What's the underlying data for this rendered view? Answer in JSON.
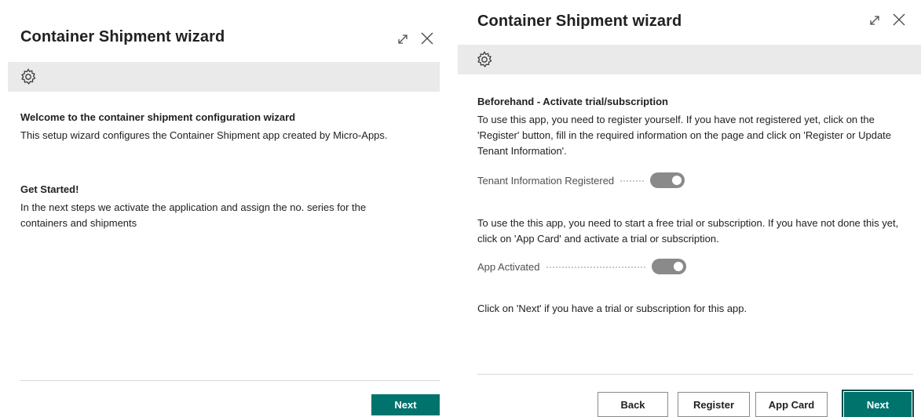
{
  "left_dialog": {
    "title": "Container Shipment wizard",
    "icons": {
      "expand": "expand-icon",
      "close": "close-icon",
      "settings": "gear-icon"
    },
    "welcome_heading": "Welcome to the container shipment configuration wizard",
    "welcome_text": "This setup wizard configures the Container Shipment app created by Micro-Apps.",
    "get_started_heading": "Get Started!",
    "get_started_text": "In the next steps we activate the application and assign the no. series for the containers and shipments",
    "buttons": {
      "next": "Next"
    }
  },
  "right_dialog": {
    "title": "Container Shipment wizard",
    "icons": {
      "expand": "expand-icon",
      "close": "close-icon",
      "settings": "gear-icon"
    },
    "heading": "Beforehand - Activate trial/subscription",
    "register_text": "To use this app, you need to register yourself. If you have not registered yet, click on the 'Register' button, fill in the required information on the page and click on 'Register or Update Tenant Information'.",
    "tenant_field": {
      "label": "Tenant Information Registered",
      "value": true
    },
    "trial_text": "To use the this app, you need to start a free trial or subscription. If you have not done this yet, click on 'App Card' and activate a trial or subscription.",
    "activated_field": {
      "label": "App Activated",
      "value": true
    },
    "next_hint": "Click on 'Next' if you have a trial or subscription for this app.",
    "buttons": {
      "back": "Back",
      "register": "Register",
      "app_card": "App Card",
      "next": "Next"
    }
  },
  "colors": {
    "primary": "#00736d",
    "toolbar": "#eaeaea",
    "toggle_on": "#8a8a8a"
  }
}
